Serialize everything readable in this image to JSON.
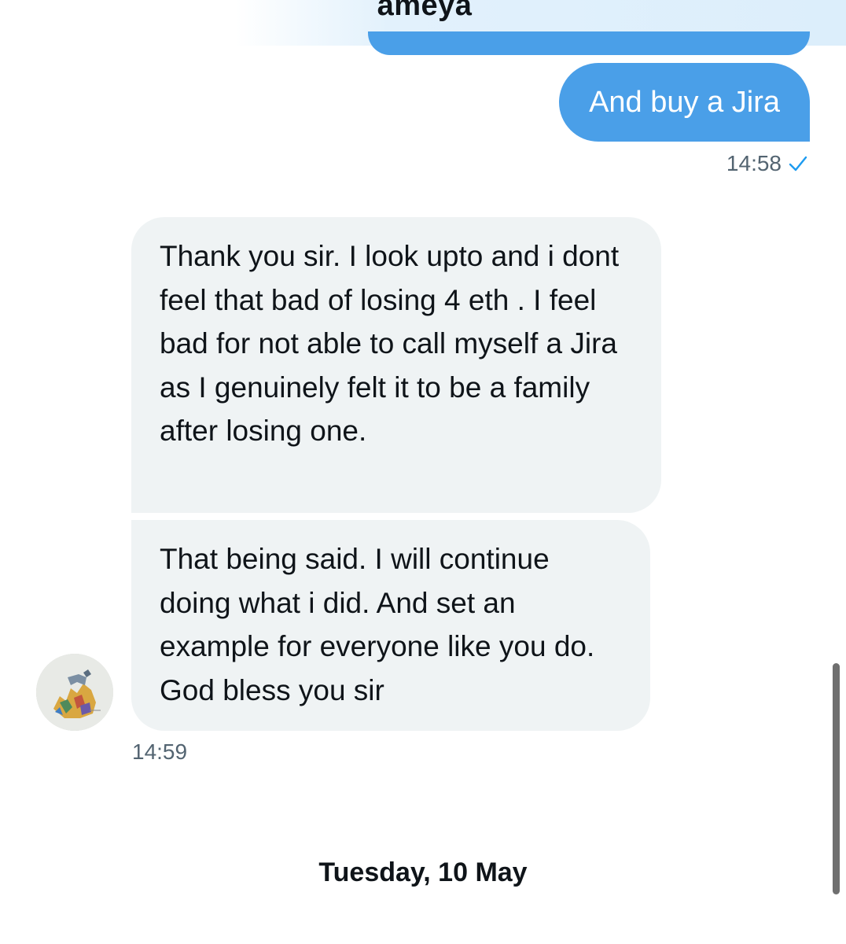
{
  "header": {
    "contact_name": "ameya"
  },
  "messages": {
    "sent": {
      "text": "And buy a Jira",
      "time": "14:58",
      "status_icon": "check-icon"
    },
    "received": [
      {
        "text": "Thank you sir. I look upto and i dont feel that bad of losing 4 eth . I feel bad for not able to call myself a Jira as I genuinely felt it to be a family after losing one."
      },
      {
        "text": "That being said. I will continue doing what i did. And set an example for everyone like you do. God bless you sir"
      }
    ],
    "received_time": "14:59"
  },
  "date_divider": "Tuesday, 10 May",
  "colors": {
    "sent_bubble": "#4a9fe8",
    "received_bubble": "#eff3f4",
    "meta_text": "#536471"
  }
}
